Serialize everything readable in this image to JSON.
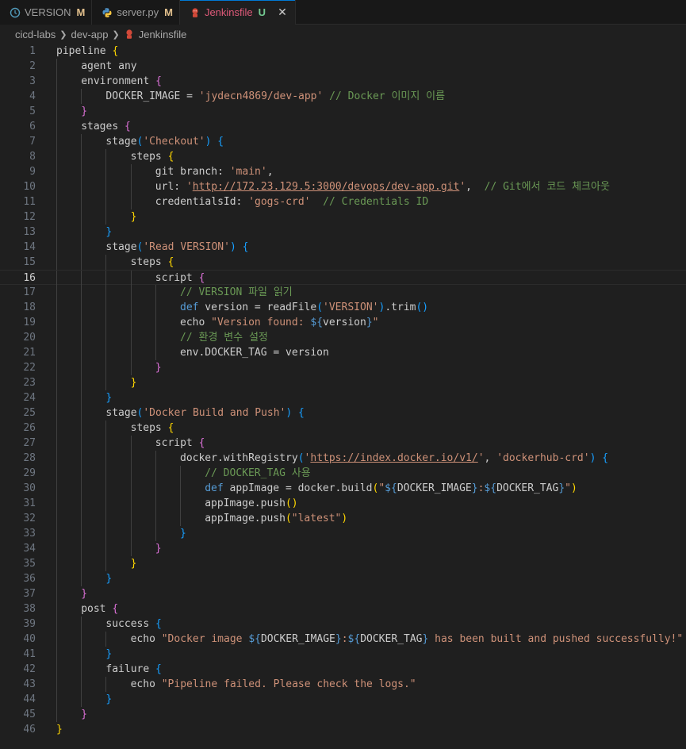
{
  "tabs": [
    {
      "name": "tab-version",
      "label": "VERSION",
      "badge": "M",
      "icon": "clock-icon",
      "active": false
    },
    {
      "name": "tab-server-py",
      "label": "server.py",
      "badge": "M",
      "icon": "python-icon",
      "active": false
    },
    {
      "name": "tab-jenkinsfile",
      "label": "Jenkinsfile",
      "badge": "U",
      "icon": "jenkins-icon",
      "active": true
    }
  ],
  "breadcrumb": [
    "cicd-labs",
    "dev-app",
    "Jenkinsfile"
  ],
  "current_line": 16,
  "colors": {
    "accent": "#0078d4",
    "active_tab": "#e05a7a",
    "modified": "#e2c08d",
    "untracked": "#73c991"
  },
  "code_lines": [
    [
      [
        "txt",
        "pipeline "
      ],
      [
        "b1",
        "{"
      ]
    ],
    [
      [
        "txt",
        "agent any"
      ]
    ],
    [
      [
        "txt",
        "environment "
      ],
      [
        "b2",
        "{"
      ]
    ],
    [
      [
        "txt",
        "DOCKER_IMAGE = "
      ],
      [
        "str",
        "'jydecn4869/dev-app'"
      ],
      [
        "txt",
        " "
      ],
      [
        "cm",
        "// Docker 이미지 이름"
      ]
    ],
    [
      [
        "b2",
        "}"
      ]
    ],
    [
      [
        "txt",
        "stages "
      ],
      [
        "b2",
        "{"
      ]
    ],
    [
      [
        "txt",
        "stage"
      ],
      [
        "b3",
        "("
      ],
      [
        "str",
        "'Checkout'"
      ],
      [
        "b3",
        ")"
      ],
      [
        "txt",
        " "
      ],
      [
        "b3",
        "{"
      ]
    ],
    [
      [
        "txt",
        "steps "
      ],
      [
        "b1",
        "{"
      ]
    ],
    [
      [
        "txt",
        "git branch: "
      ],
      [
        "str",
        "'main'"
      ],
      [
        "txt",
        ","
      ]
    ],
    [
      [
        "txt",
        "url: "
      ],
      [
        "str",
        "'"
      ],
      [
        "str ul",
        "http://172.23.129.5:3000/devops/dev-app.git"
      ],
      [
        "str",
        "'"
      ],
      [
        "txt",
        ",  "
      ],
      [
        "cm",
        "// Git에서 코드 체크아웃"
      ]
    ],
    [
      [
        "txt",
        "credentialsId: "
      ],
      [
        "str",
        "'gogs-crd'"
      ],
      [
        "txt",
        "  "
      ],
      [
        "cm",
        "// Credentials ID"
      ]
    ],
    [
      [
        "b1",
        "}"
      ]
    ],
    [
      [
        "b3",
        "}"
      ]
    ],
    [
      [
        "txt",
        "stage"
      ],
      [
        "b3",
        "("
      ],
      [
        "str",
        "'Read VERSION'"
      ],
      [
        "b3",
        ")"
      ],
      [
        "txt",
        " "
      ],
      [
        "b3",
        "{"
      ]
    ],
    [
      [
        "txt",
        "steps "
      ],
      [
        "b1",
        "{"
      ]
    ],
    [
      [
        "txt",
        "script "
      ],
      [
        "b2",
        "{"
      ]
    ],
    [
      [
        "cm",
        "// VERSION 파일 읽기"
      ]
    ],
    [
      [
        "kw",
        "def"
      ],
      [
        "txt",
        " version = readFile"
      ],
      [
        "b3",
        "("
      ],
      [
        "str",
        "'VERSION'"
      ],
      [
        "b3",
        ")"
      ],
      [
        "txt",
        ".trim"
      ],
      [
        "b3",
        "()"
      ]
    ],
    [
      [
        "txt",
        "echo "
      ],
      [
        "str",
        "\"Version found: "
      ],
      [
        "kw",
        "${"
      ],
      [
        "txt",
        "version"
      ],
      [
        "kw",
        "}"
      ],
      [
        "str",
        "\""
      ]
    ],
    [
      [
        "cm",
        "// 환경 변수 설정"
      ]
    ],
    [
      [
        "txt",
        "env.DOCKER_TAG = version"
      ]
    ],
    [
      [
        "b2",
        "}"
      ]
    ],
    [
      [
        "b1",
        "}"
      ]
    ],
    [
      [
        "b3",
        "}"
      ]
    ],
    [
      [
        "txt",
        "stage"
      ],
      [
        "b3",
        "("
      ],
      [
        "str",
        "'Docker Build and Push'"
      ],
      [
        "b3",
        ")"
      ],
      [
        "txt",
        " "
      ],
      [
        "b3",
        "{"
      ]
    ],
    [
      [
        "txt",
        "steps "
      ],
      [
        "b1",
        "{"
      ]
    ],
    [
      [
        "txt",
        "script "
      ],
      [
        "b2",
        "{"
      ]
    ],
    [
      [
        "txt",
        "docker.withRegistry"
      ],
      [
        "b3",
        "("
      ],
      [
        "str",
        "'"
      ],
      [
        "str ul",
        "https://index.docker.io/v1/"
      ],
      [
        "str",
        "'"
      ],
      [
        "txt",
        ", "
      ],
      [
        "str",
        "'dockerhub-crd'"
      ],
      [
        "b3",
        ")"
      ],
      [
        "txt",
        " "
      ],
      [
        "b3",
        "{"
      ]
    ],
    [
      [
        "cm",
        "// DOCKER_TAG 사용"
      ]
    ],
    [
      [
        "kw",
        "def"
      ],
      [
        "txt",
        " appImage = docker.build"
      ],
      [
        "b1",
        "("
      ],
      [
        "str",
        "\""
      ],
      [
        "kw",
        "${"
      ],
      [
        "txt",
        "DOCKER_IMAGE"
      ],
      [
        "kw",
        "}"
      ],
      [
        "str",
        ":"
      ],
      [
        "kw",
        "${"
      ],
      [
        "txt",
        "DOCKER_TAG"
      ],
      [
        "kw",
        "}"
      ],
      [
        "str",
        "\""
      ],
      [
        "b1",
        ")"
      ]
    ],
    [
      [
        "txt",
        "appImage.push"
      ],
      [
        "b1",
        "()"
      ]
    ],
    [
      [
        "txt",
        "appImage.push"
      ],
      [
        "b1",
        "("
      ],
      [
        "str",
        "\"latest\""
      ],
      [
        "b1",
        ")"
      ]
    ],
    [
      [
        "b3",
        "}"
      ]
    ],
    [
      [
        "b2",
        "}"
      ]
    ],
    [
      [
        "b1",
        "}"
      ]
    ],
    [
      [
        "b3",
        "}"
      ]
    ],
    [
      [
        "b2",
        "}"
      ]
    ],
    [
      [
        "txt",
        "post "
      ],
      [
        "b2",
        "{"
      ]
    ],
    [
      [
        "txt",
        "success "
      ],
      [
        "b3",
        "{"
      ]
    ],
    [
      [
        "txt",
        "echo "
      ],
      [
        "str",
        "\"Docker image "
      ],
      [
        "kw",
        "${"
      ],
      [
        "txt",
        "DOCKER_IMAGE"
      ],
      [
        "kw",
        "}"
      ],
      [
        "str",
        ":"
      ],
      [
        "kw",
        "${"
      ],
      [
        "txt",
        "DOCKER_TAG"
      ],
      [
        "kw",
        "}"
      ],
      [
        "str",
        " has been built and pushed successfully!\""
      ]
    ],
    [
      [
        "b3",
        "}"
      ]
    ],
    [
      [
        "txt",
        "failure "
      ],
      [
        "b3",
        "{"
      ]
    ],
    [
      [
        "txt",
        "echo "
      ],
      [
        "str",
        "\"Pipeline failed. Please check the logs.\""
      ]
    ],
    [
      [
        "b3",
        "}"
      ]
    ],
    [
      [
        "b2",
        "}"
      ]
    ],
    [
      [
        "b1",
        "}"
      ]
    ]
  ]
}
